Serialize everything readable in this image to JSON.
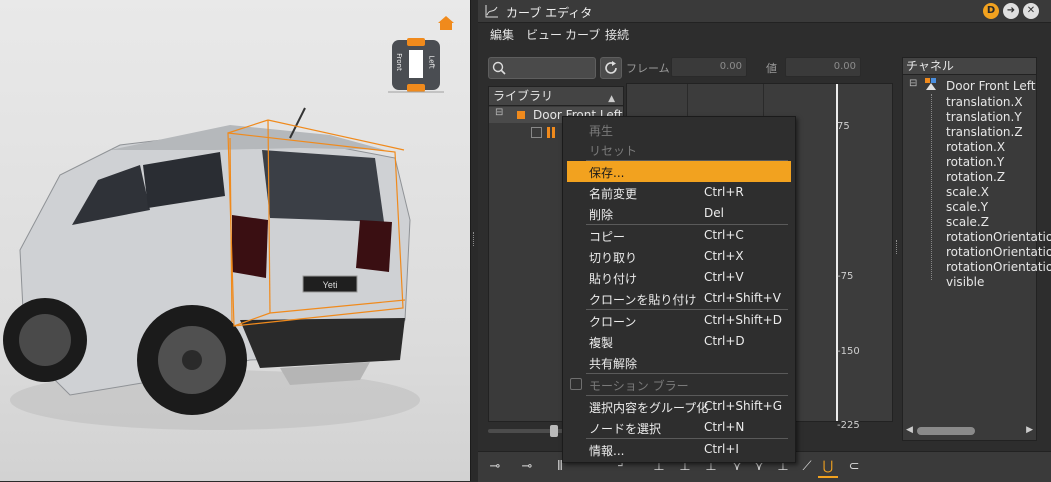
{
  "window": {
    "title": "カーブ エディタ"
  },
  "menubar": [
    "編集",
    "ビュー",
    "カーブ",
    "接続"
  ],
  "toolbar": {
    "frame_label": "フレーム",
    "frame_value": "0.00",
    "value_label": "値",
    "value_value": "0.00"
  },
  "viewcube": {
    "front": "Front",
    "left": "Left"
  },
  "car": {
    "plate": "Yeti"
  },
  "library": {
    "header": "ライブラリ",
    "item": "Door Front Left"
  },
  "graph": {
    "ticks": [
      "75",
      "-75",
      "-150",
      "-225"
    ]
  },
  "channels": {
    "header": "チャネル",
    "root": "Door Front Left",
    "items": [
      "translation.X",
      "translation.Y",
      "translation.Z",
      "rotation.X",
      "rotation.Y",
      "rotation.Z",
      "scale.X",
      "scale.Y",
      "scale.Z",
      "rotationOrientation",
      "rotationOrientation",
      "rotationOrientation",
      "visible"
    ]
  },
  "context_menu": {
    "items": [
      {
        "label": "再生",
        "shortcut": "",
        "state": "disabled"
      },
      {
        "label": "リセット",
        "shortcut": "",
        "state": "disabled"
      },
      {
        "label": "保存...",
        "shortcut": "",
        "state": "highlighted"
      },
      {
        "label": "名前変更",
        "shortcut": "Ctrl+R",
        "state": "normal"
      },
      {
        "label": "削除",
        "shortcut": "Del",
        "state": "normal"
      },
      {
        "label": "コピー",
        "shortcut": "Ctrl+C",
        "state": "normal"
      },
      {
        "label": "切り取り",
        "shortcut": "Ctrl+X",
        "state": "normal"
      },
      {
        "label": "貼り付け",
        "shortcut": "Ctrl+V",
        "state": "normal"
      },
      {
        "label": "クローンを貼り付け",
        "shortcut": "Ctrl+Shift+V",
        "state": "normal"
      },
      {
        "label": "クローン",
        "shortcut": "Ctrl+Shift+D",
        "state": "normal"
      },
      {
        "label": "複製",
        "shortcut": "Ctrl+D",
        "state": "normal"
      },
      {
        "label": "共有解除",
        "shortcut": "",
        "state": "normal"
      },
      {
        "label": "モーション ブラー",
        "shortcut": "",
        "state": "disabled-checkbox"
      },
      {
        "label": "選択内容をグループ化",
        "shortcut": "Ctrl+Shift+G",
        "state": "normal"
      },
      {
        "label": "ノードを選択",
        "shortcut": "Ctrl+N",
        "state": "normal"
      },
      {
        "label": "情報...",
        "shortcut": "Ctrl+I",
        "state": "normal"
      }
    ]
  },
  "colors": {
    "accent": "#f2a21f",
    "panel": "#2d2d2d",
    "bbox": "#f08a1c"
  }
}
